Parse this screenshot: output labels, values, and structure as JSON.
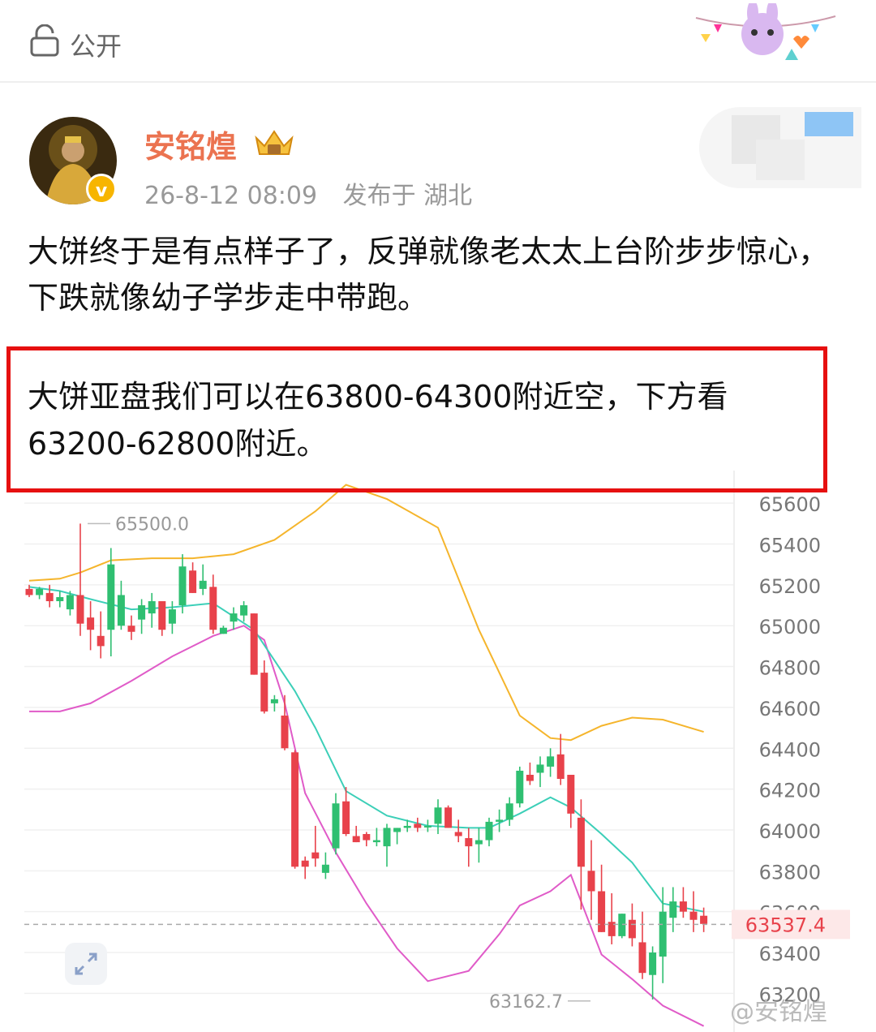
{
  "header": {
    "visibility_label": "公开",
    "lock_icon": "lock-icon"
  },
  "post": {
    "username": "安铭煌",
    "timestamp": "26-8-12 08:09",
    "location": "发布于 湖北",
    "text": "大饼终于是有点样子了，反弹就像老太太上台阶步步惊心，下跌就像幼子学步走中带跑。",
    "highlight_text": "大饼亚盘我们可以在63800-64300附近空，下方看63200-62800附近。"
  },
  "watermark": "@安铭煌",
  "colors": {
    "username": "#eb7350",
    "highlight_border": "#e61010",
    "up": "#2fbf71",
    "down": "#e8424b",
    "upper_band": "#f5b52c",
    "mid_band": "#3ccfb8",
    "lower_band": "#e05bc8",
    "price_line": "#e8424b"
  },
  "chart_data": {
    "type": "candlestick",
    "y_ticks": [
      63200,
      63400,
      63600,
      63800,
      64000,
      64200,
      64400,
      64600,
      64800,
      65000,
      65200,
      65400,
      65600
    ],
    "ylim": [
      63130,
      65680
    ],
    "high_label": "65500.0",
    "low_label": "63162.7",
    "current_price": 63537.4,
    "candles": [
      [
        65180,
        65200,
        65140,
        65150
      ],
      [
        65150,
        65190,
        65130,
        65180
      ],
      [
        65160,
        65200,
        65090,
        65120
      ],
      [
        65120,
        65170,
        65090,
        65140
      ],
      [
        65080,
        65170,
        65050,
        65150
      ],
      [
        65150,
        65500,
        64950,
        65010
      ],
      [
        65040,
        65120,
        64880,
        64980
      ],
      [
        64950,
        65070,
        64840,
        64900
      ],
      [
        64980,
        65380,
        64850,
        65300
      ],
      [
        65000,
        65220,
        64980,
        65150
      ],
      [
        65000,
        65050,
        64930,
        64970
      ],
      [
        65030,
        65130,
        64960,
        65100
      ],
      [
        65060,
        65160,
        64990,
        65120
      ],
      [
        65120,
        65100,
        64950,
        64980
      ],
      [
        65010,
        65120,
        64960,
        65080
      ],
      [
        65100,
        65350,
        65060,
        65290
      ],
      [
        65270,
        65310,
        65160,
        65160
      ],
      [
        65180,
        65300,
        65150,
        65220
      ],
      [
        65190,
        65250,
        64960,
        64980
      ],
      [
        64960,
        65000,
        64960,
        64990
      ],
      [
        65020,
        65090,
        64980,
        65060
      ],
      [
        65050,
        65120,
        65020,
        65100
      ],
      [
        65060,
        64870,
        65080,
        64760
      ],
      [
        64770,
        64830,
        64570,
        64580
      ],
      [
        64620,
        64660,
        64580,
        64640
      ],
      [
        64560,
        64660,
        64390,
        64400
      ],
      [
        64380,
        64390,
        63810,
        63820
      ],
      [
        63850,
        63870,
        63760,
        63820
      ],
      [
        63890,
        64020,
        63820,
        63860
      ],
      [
        63790,
        63890,
        63760,
        63830
      ],
      [
        63910,
        64180,
        63880,
        64130
      ],
      [
        64140,
        64210,
        63970,
        63980
      ],
      [
        63970,
        64020,
        63940,
        63940
      ],
      [
        63980,
        63990,
        63920,
        63950
      ],
      [
        63940,
        64010,
        63920,
        63950
      ],
      [
        63920,
        64030,
        63820,
        64010
      ],
      [
        63990,
        64010,
        63930,
        64010
      ],
      [
        64010,
        64050,
        63990,
        64020
      ],
      [
        64030,
        64060,
        63990,
        64010
      ],
      [
        64020,
        64050,
        63990,
        64020
      ],
      [
        64030,
        64150,
        63980,
        64110
      ],
      [
        64110,
        64120,
        64010,
        64010
      ],
      [
        63990,
        64050,
        63940,
        63970
      ],
      [
        63960,
        64010,
        63820,
        63920
      ],
      [
        63930,
        64010,
        63840,
        63950
      ],
      [
        63950,
        64060,
        63920,
        64040
      ],
      [
        64040,
        64100,
        63990,
        64050
      ],
      [
        64050,
        64160,
        64020,
        64130
      ],
      [
        64130,
        64310,
        64110,
        64290
      ],
      [
        64270,
        64330,
        64220,
        64240
      ],
      [
        64280,
        64360,
        64210,
        64320
      ],
      [
        64310,
        64400,
        64260,
        64360
      ],
      [
        64370,
        64470,
        64220,
        64250
      ],
      [
        64270,
        64270,
        64010,
        64080
      ],
      [
        64060,
        64150,
        63610,
        63820
      ],
      [
        63800,
        63950,
        63560,
        63700
      ],
      [
        63700,
        63830,
        63510,
        63500
      ],
      [
        63550,
        63690,
        63440,
        63480
      ],
      [
        63480,
        63570,
        63470,
        63590
      ],
      [
        63560,
        63640,
        63430,
        63470
      ],
      [
        63450,
        63600,
        63270,
        63300
      ],
      [
        63290,
        63430,
        63170,
        63400
      ],
      [
        63380,
        63720,
        63250,
        63600
      ],
      [
        63570,
        63720,
        63500,
        63650
      ],
      [
        63650,
        63720,
        63570,
        63600
      ],
      [
        63600,
        63700,
        63500,
        63560
      ],
      [
        63580,
        63620,
        63500,
        63540
      ]
    ],
    "upper_band": [
      [
        0,
        65220
      ],
      [
        3,
        65230
      ],
      [
        5,
        65260
      ],
      [
        8,
        65320
      ],
      [
        12,
        65330
      ],
      [
        16,
        65330
      ],
      [
        20,
        65350
      ],
      [
        24,
        65420
      ],
      [
        28,
        65560
      ],
      [
        31,
        65690
      ],
      [
        35,
        65620
      ],
      [
        40,
        65480
      ],
      [
        44,
        64980
      ],
      [
        48,
        64560
      ],
      [
        51,
        64450
      ],
      [
        53,
        64440
      ],
      [
        56,
        64510
      ],
      [
        59,
        64550
      ],
      [
        62,
        64540
      ],
      [
        66,
        64480
      ]
    ],
    "mid_band": [
      [
        0,
        65190
      ],
      [
        3,
        65170
      ],
      [
        6,
        65130
      ],
      [
        10,
        65080
      ],
      [
        14,
        65090
      ],
      [
        18,
        65110
      ],
      [
        22,
        64980
      ],
      [
        26,
        64680
      ],
      [
        28,
        64500
      ],
      [
        31,
        64190
      ],
      [
        35,
        64070
      ],
      [
        39,
        64020
      ],
      [
        43,
        64010
      ],
      [
        45,
        64010
      ],
      [
        48,
        64080
      ],
      [
        51,
        64160
      ],
      [
        53,
        64110
      ],
      [
        56,
        63980
      ],
      [
        59,
        63840
      ],
      [
        62,
        63640
      ],
      [
        66,
        63600
      ]
    ],
    "lower_band": [
      [
        0,
        64580
      ],
      [
        3,
        64580
      ],
      [
        6,
        64620
      ],
      [
        10,
        64730
      ],
      [
        14,
        64850
      ],
      [
        18,
        64950
      ],
      [
        21,
        65000
      ],
      [
        23,
        64930
      ],
      [
        25,
        64620
      ],
      [
        27,
        64180
      ],
      [
        30,
        63890
      ],
      [
        33,
        63640
      ],
      [
        36,
        63420
      ],
      [
        39,
        63260
      ],
      [
        43,
        63310
      ],
      [
        46,
        63490
      ],
      [
        48,
        63630
      ],
      [
        51,
        63700
      ],
      [
        53,
        63780
      ],
      [
        56,
        63390
      ],
      [
        59,
        63270
      ],
      [
        62,
        63140
      ],
      [
        66,
        63040
      ]
    ]
  }
}
